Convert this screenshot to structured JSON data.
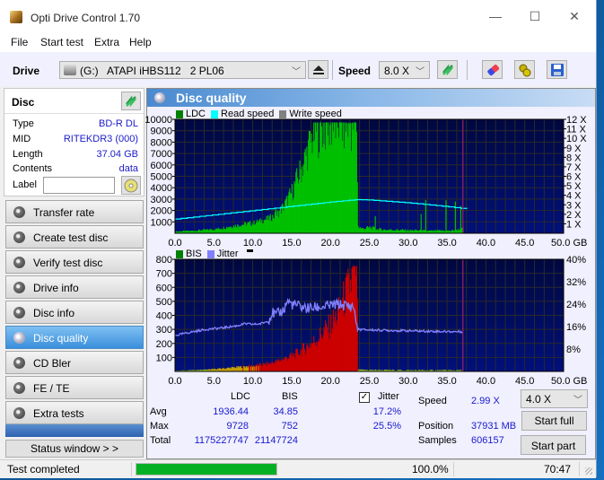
{
  "window": {
    "title": "Opti Drive Control 1.70",
    "controls": {
      "minimize": "—",
      "maximize": "☐",
      "close": "✕"
    }
  },
  "menu": [
    "File",
    "Start test",
    "Extra",
    "Help"
  ],
  "toolbar": {
    "drive_label": "Drive",
    "drive_value": "(G:)   ATAPI iHBS112   2 PL06",
    "speed_label": "Speed",
    "speed_value": "8.0 X",
    "icons": [
      "drive-icon",
      "eject-icon",
      "refresh-icon",
      "erase-icon",
      "settings-icon",
      "save-icon"
    ]
  },
  "disc": {
    "header": "Disc",
    "fields": [
      {
        "label": "Type",
        "value": "BD-R DL"
      },
      {
        "label": "MID",
        "value": "RITEKDR3 (000)"
      },
      {
        "label": "Length",
        "value": "37.04 GB"
      },
      {
        "label": "Contents",
        "value": "data"
      }
    ],
    "label_field": {
      "label": "Label",
      "value": ""
    }
  },
  "nav": [
    {
      "label": "Transfer rate",
      "active": false
    },
    {
      "label": "Create test disc",
      "active": false
    },
    {
      "label": "Verify test disc",
      "active": false
    },
    {
      "label": "Drive info",
      "active": false
    },
    {
      "label": "Disc info",
      "active": false
    },
    {
      "label": "Disc quality",
      "active": true
    },
    {
      "label": "CD Bler",
      "active": false
    },
    {
      "label": "FE / TE",
      "active": false
    },
    {
      "label": "Extra tests",
      "active": false
    }
  ],
  "status_window_button": "Status window > >",
  "panel": {
    "title": "Disc quality"
  },
  "colors": {
    "ldc": "#00c000",
    "read_speed": "#00ffff",
    "write_speed": "#808080",
    "bis": "#008000",
    "jitter": "#8080ff",
    "bis_fill": "#cc0000",
    "plot_bg_top": "#000840",
    "plot_bg_bottom": "#00107a",
    "grid": "#2a2a2a",
    "end_marker": "#a0206a"
  },
  "chart_data": [
    {
      "type": "bar",
      "title": "LDC",
      "legend": [
        "LDC",
        "Read speed",
        "Write speed"
      ],
      "legend_position": "top-left",
      "xlabel": "GB",
      "x_ticks": [
        "0.0",
        "5.0",
        "10.0",
        "15.0",
        "20.0",
        "25.0",
        "30.0",
        "35.0",
        "40.0",
        "45.0",
        "50.0 GB"
      ],
      "xlim": [
        0,
        50
      ],
      "y_ticks": [
        "1000",
        "2000",
        "3000",
        "4000",
        "5000",
        "6000",
        "7000",
        "8000",
        "9000",
        "10000"
      ],
      "ylim": [
        0,
        10000
      ],
      "y2_ticks": [
        "1 X",
        "2 X",
        "3 X",
        "4 X",
        "5 X",
        "6 X",
        "7 X",
        "8 X",
        "9 X",
        "10 X",
        "11 X",
        "12 X"
      ],
      "y2lim": [
        0,
        12
      ],
      "disc_end_gb": 37.04,
      "grid": true,
      "series": [
        {
          "name": "LDC",
          "x": [
            0,
            1,
            2,
            3,
            4,
            5,
            6,
            7,
            8,
            9,
            10,
            11,
            12,
            13,
            13.5,
            14,
            14.5,
            15,
            15.5,
            16,
            16.5,
            17,
            17.5,
            18,
            18.5,
            19,
            19.5,
            20,
            21,
            22,
            23,
            23.3,
            23.5,
            24,
            25,
            26,
            27,
            28,
            29,
            30,
            31,
            32,
            33,
            34,
            35,
            36,
            37
          ],
          "values": [
            150,
            180,
            200,
            250,
            300,
            350,
            450,
            600,
            700,
            800,
            900,
            1100,
            1300,
            1600,
            2000,
            2400,
            3000,
            3600,
            4500,
            5300,
            6200,
            7200,
            8200,
            9000,
            9500,
            9700,
            9728,
            9700,
            9700,
            9700,
            9700,
            9700,
            600,
            400,
            500,
            350,
            300,
            300,
            280,
            250,
            250,
            220,
            200,
            220,
            200,
            250,
            400
          ]
        },
        {
          "name": "Read speed",
          "x": [
            0,
            5,
            10,
            15,
            20,
            23.3,
            23.5,
            25,
            30,
            35,
            37
          ],
          "values": [
            1.5,
            1.95,
            2.4,
            2.85,
            3.3,
            3.55,
            3.55,
            3.5,
            3.2,
            2.8,
            2.6
          ]
        }
      ]
    },
    {
      "type": "bar",
      "title": "BIS / Jitter",
      "legend": [
        "BIS",
        "Jitter"
      ],
      "legend_position": "top-left",
      "xlabel": "GB",
      "x_ticks": [
        "0.0",
        "5.0",
        "10.0",
        "15.0",
        "20.0",
        "25.0",
        "30.0",
        "35.0",
        "40.0",
        "45.0",
        "50.0 GB"
      ],
      "xlim": [
        0,
        50
      ],
      "y_ticks": [
        "100",
        "200",
        "300",
        "400",
        "500",
        "600",
        "700",
        "800"
      ],
      "ylim": [
        0,
        800
      ],
      "y2_ticks": [
        "8%",
        "16%",
        "24%",
        "32%",
        "40%"
      ],
      "y2lim": [
        0,
        40
      ],
      "disc_end_gb": 37.04,
      "grid": true,
      "series": [
        {
          "name": "BIS",
          "x": [
            0,
            2,
            4,
            6,
            8,
            10,
            12,
            13,
            14,
            15,
            16,
            17,
            18,
            19,
            20,
            21,
            22,
            22.5,
            23,
            23.3,
            23.5,
            25,
            30,
            35,
            37
          ],
          "values": [
            5,
            8,
            12,
            20,
            30,
            40,
            55,
            70,
            90,
            110,
            140,
            180,
            220,
            280,
            330,
            420,
            560,
            620,
            700,
            752,
            10,
            10,
            8,
            8,
            8
          ]
        },
        {
          "name": "Jitter",
          "x": [
            0,
            2,
            4,
            6,
            8,
            9,
            10,
            11,
            12,
            12.5,
            13,
            14,
            14.5,
            15,
            17,
            19,
            21,
            23,
            23.5,
            25,
            30,
            35,
            37
          ],
          "values": [
            12.8,
            14,
            15,
            15.5,
            16.3,
            17,
            16.8,
            17,
            18,
            21,
            20,
            22,
            25.5,
            24,
            22.5,
            23,
            24,
            23,
            15,
            14.8,
            14.5,
            14.2,
            14.2
          ]
        }
      ]
    }
  ],
  "stats": {
    "headers": [
      "LDC",
      "BIS"
    ],
    "rows": [
      {
        "label": "Avg",
        "ldc": "1936.44",
        "bis": "34.85",
        "jitter": "17.2%"
      },
      {
        "label": "Max",
        "ldc": "9728",
        "bis": "752",
        "jitter": "25.5%"
      },
      {
        "label": "Total",
        "ldc": "1175227747",
        "bis": "21147724"
      }
    ],
    "jitter_label": "Jitter",
    "jitter_checked": true
  },
  "run": {
    "speed_label": "Speed",
    "speed_value": "2.99 X",
    "position_label": "Position",
    "position_value": "37931 MB",
    "samples_label": "Samples",
    "samples_value": "606157",
    "speed_select": "4.0 X",
    "start_full": "Start full",
    "start_part": "Start part"
  },
  "statusbar": {
    "text": "Test completed",
    "progress": 1.0,
    "progress_text": "100.0%",
    "elapsed": "70:47"
  }
}
